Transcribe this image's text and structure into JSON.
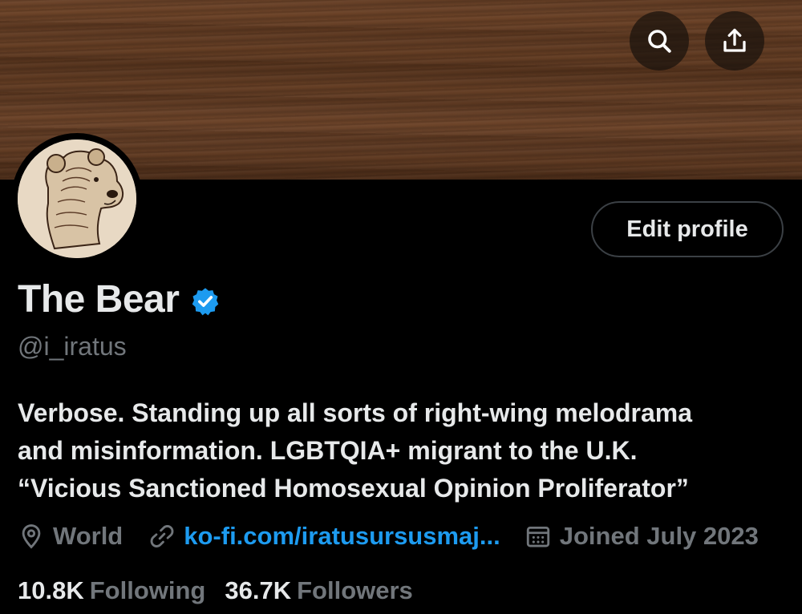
{
  "header": {
    "search_icon": "search-icon",
    "share_icon": "share-icon",
    "banner": "wood-texture"
  },
  "profile": {
    "name": "The Bear",
    "verified": true,
    "handle": "@i_iratus",
    "edit_button_label": "Edit profile",
    "bio_lines": [
      "Verbose. Standing up all sorts of right-wing melodrama",
      "and misinformation. LGBTQIA+ migrant to the U.K.",
      "“Vicious Sanctioned Homosexual Opinion Proliferator”"
    ],
    "location": "World",
    "website": "ko-fi.com/iratusursusmaj...",
    "joined": "Joined July 2023",
    "following_count": "10.8K",
    "following_label": "Following",
    "followers_count": "36.7K",
    "followers_label": "Followers"
  },
  "colors": {
    "background": "#000000",
    "text_primary": "#e7e9ea",
    "text_secondary": "#71767b",
    "link": "#1d9bf0",
    "verified_badge": "#1d9bf0",
    "banner_wood": "#5a3720"
  }
}
